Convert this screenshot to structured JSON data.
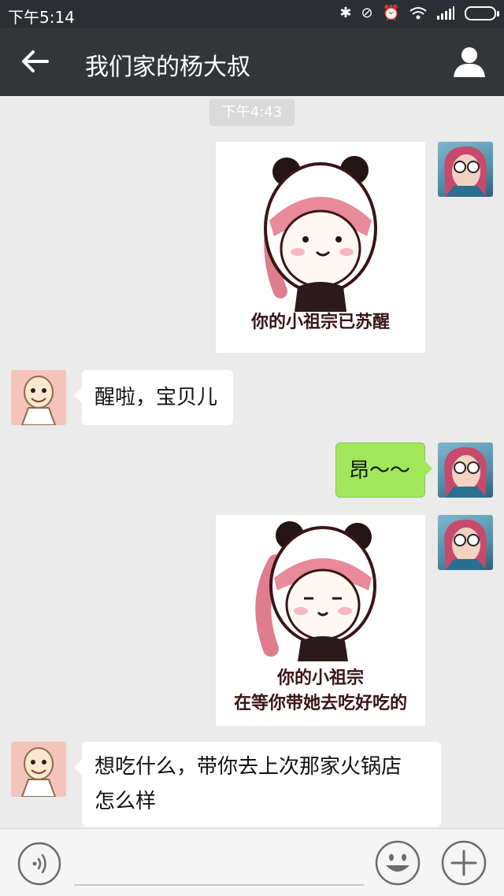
{
  "status_bar": {
    "time": "下午5:14",
    "icons": [
      "bluetooth-icon",
      "mute-icon",
      "alarm-icon",
      "wifi-icon",
      "signal-icon",
      "battery-icon"
    ]
  },
  "header": {
    "title": "我们家的杨大叔",
    "back_icon": "back-arrow-icon",
    "profile_icon": "user-profile-icon"
  },
  "chat": {
    "timestamp": "下午4:43",
    "messages": [
      {
        "sender": "me",
        "type": "sticker",
        "caption_lines": [
          "你的小祖宗已苏醒"
        ]
      },
      {
        "sender": "other",
        "type": "text",
        "text": "醒啦，宝贝儿"
      },
      {
        "sender": "me",
        "type": "text",
        "text": "昂～～"
      },
      {
        "sender": "me",
        "type": "sticker",
        "caption_lines": [
          "你的小祖宗",
          "在等你带她去吃好吃的"
        ]
      },
      {
        "sender": "other",
        "type": "text",
        "text_lines": [
          "想吃什么，带你去上次那家火锅店",
          "怎么样"
        ]
      }
    ]
  },
  "input_bar": {
    "voice_icon": "voice-input-icon",
    "emoji_icon": "emoji-icon",
    "plus_icon": "plus-icon"
  },
  "colors": {
    "nav_bg": "#333639",
    "chat_bg": "#ebebeb",
    "my_bubble": "#a0e75a",
    "their_bubble": "#ffffff",
    "sticker_text": "#3a1416"
  }
}
